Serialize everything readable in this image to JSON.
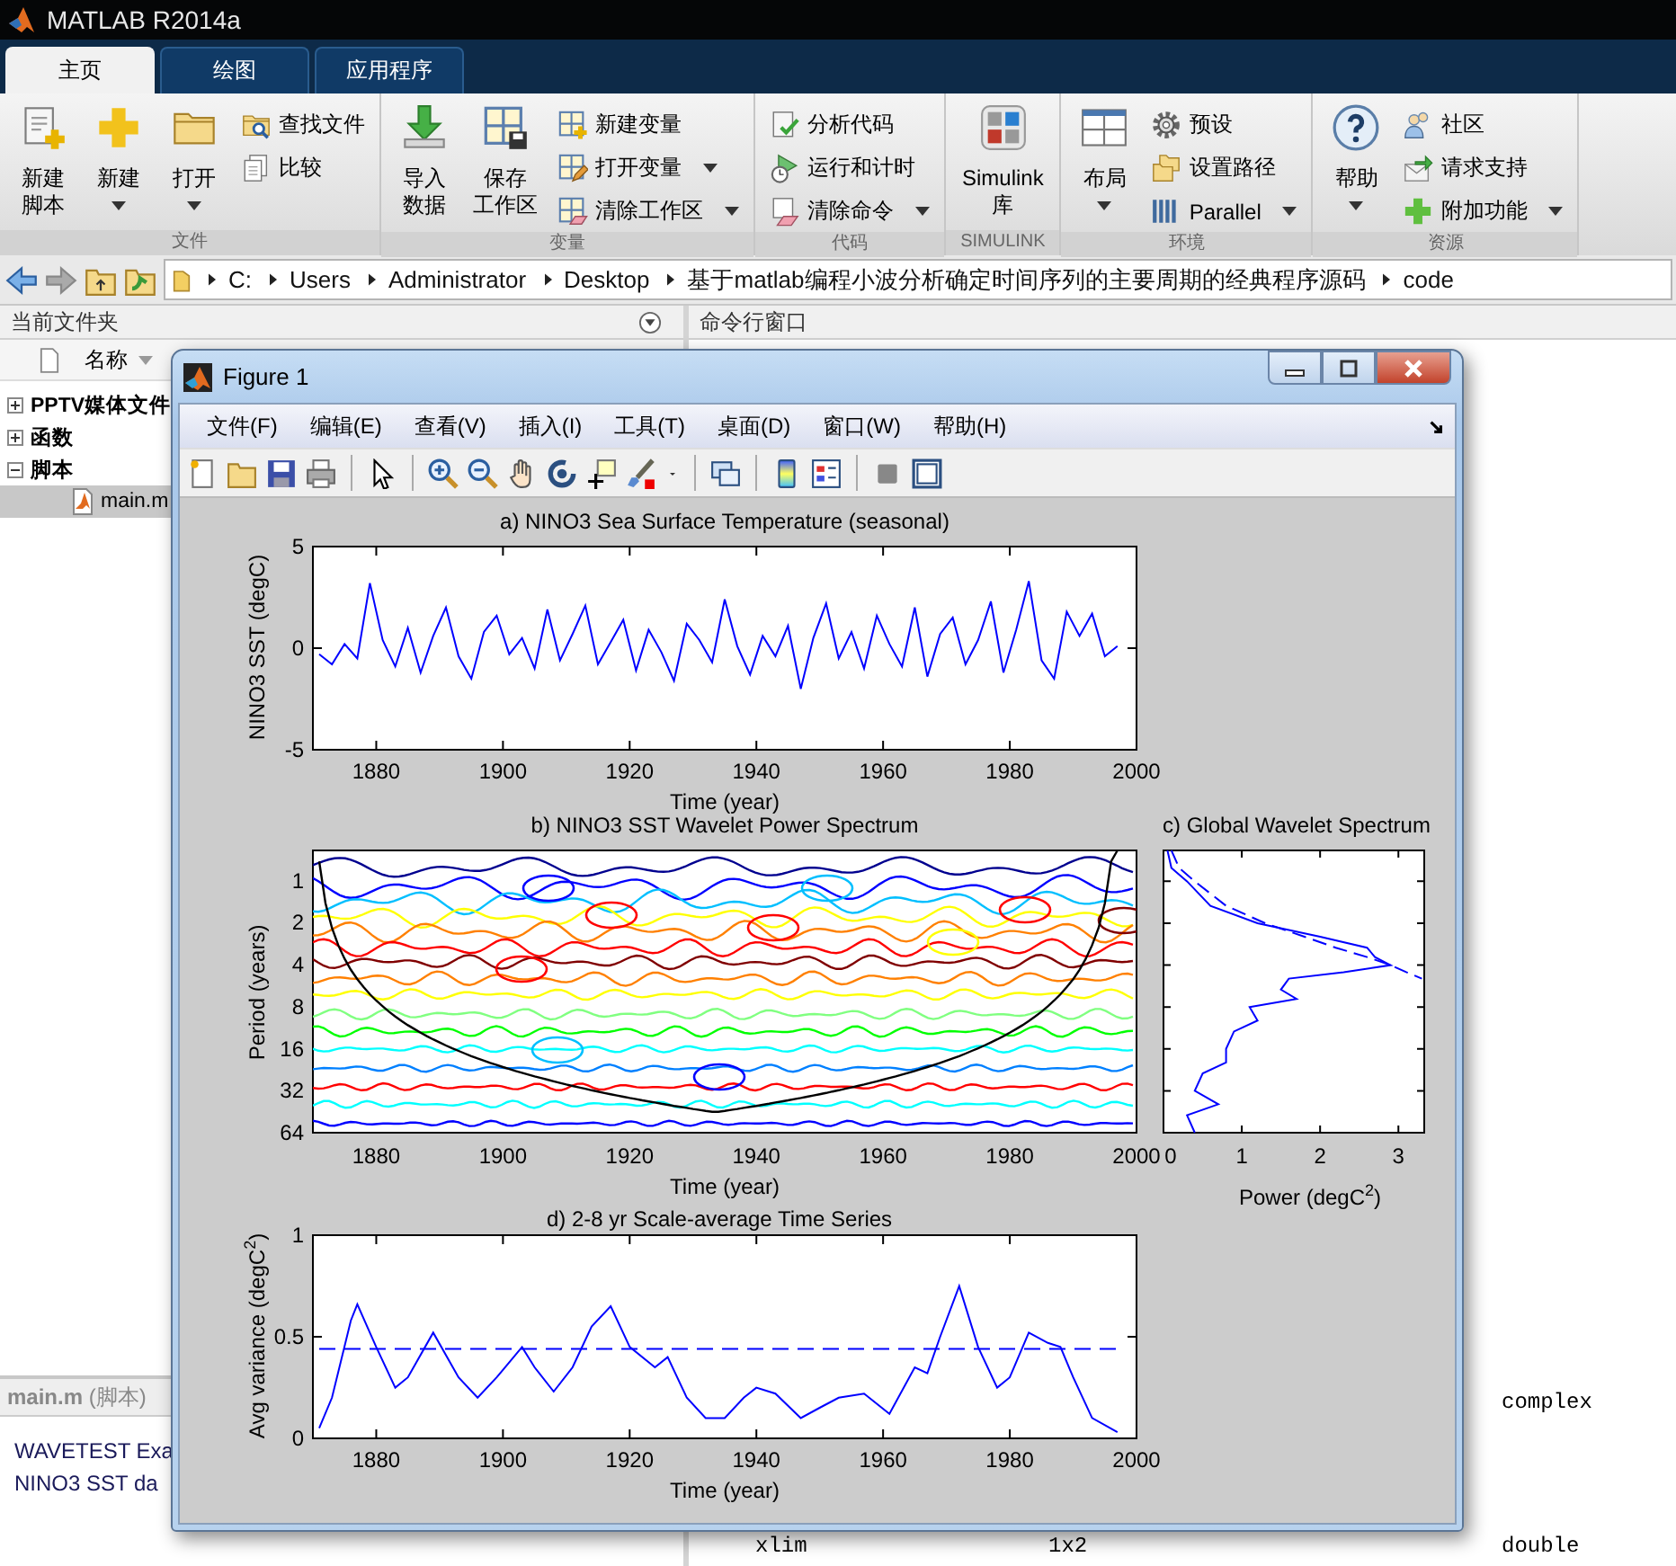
{
  "window": {
    "title": "MATLAB R2014a"
  },
  "tabs": [
    {
      "label": "主页",
      "selected": true
    },
    {
      "label": "绘图",
      "selected": false
    },
    {
      "label": "应用程序",
      "selected": false
    }
  ],
  "toolstrip": {
    "sections": [
      {
        "label": "文件",
        "items": [
          {
            "kind": "large",
            "lines": [
              "新建",
              "脚本"
            ],
            "dropdown": false
          },
          {
            "kind": "large",
            "lines": [
              "新建"
            ],
            "dropdown": true
          },
          {
            "kind": "large",
            "lines": [
              "打开"
            ],
            "dropdown": true
          },
          {
            "kind": "stack",
            "buttons": [
              {
                "label": "查找文件",
                "dropdown": false
              },
              {
                "label": "比较",
                "dropdown": false
              }
            ]
          }
        ]
      },
      {
        "label": "变量",
        "items": [
          {
            "kind": "large",
            "lines": [
              "导入",
              "数据"
            ],
            "dropdown": false
          },
          {
            "kind": "large",
            "lines": [
              "保存",
              "工作区"
            ],
            "dropdown": false
          },
          {
            "kind": "stack",
            "buttons": [
              {
                "label": "新建变量",
                "dropdown": false
              },
              {
                "label": "打开变量",
                "dropdown": true
              },
              {
                "label": "清除工作区",
                "dropdown": true
              }
            ]
          }
        ]
      },
      {
        "label": "代码",
        "items": [
          {
            "kind": "stack",
            "buttons": [
              {
                "label": "分析代码",
                "dropdown": false
              },
              {
                "label": "运行和计时",
                "dropdown": false
              },
              {
                "label": "清除命令",
                "dropdown": true
              }
            ]
          }
        ]
      },
      {
        "label": "SIMULINK",
        "items": [
          {
            "kind": "large",
            "lines": [
              "Simulink",
              "库"
            ],
            "dropdown": false
          }
        ]
      },
      {
        "label": "环境",
        "items": [
          {
            "kind": "large",
            "lines": [
              "布局"
            ],
            "dropdown": true
          },
          {
            "kind": "stack",
            "buttons": [
              {
                "label": "预设",
                "dropdown": false
              },
              {
                "label": "设置路径",
                "dropdown": false
              },
              {
                "label": "Parallel",
                "dropdown": true
              }
            ]
          }
        ]
      },
      {
        "label": "资源",
        "items": [
          {
            "kind": "large",
            "lines": [
              "帮助"
            ],
            "dropdown": true
          },
          {
            "kind": "stack",
            "buttons": [
              {
                "label": "社区",
                "dropdown": false
              },
              {
                "label": "请求支持",
                "dropdown": false
              },
              {
                "label": "附加功能",
                "dropdown": true
              }
            ]
          }
        ]
      }
    ]
  },
  "address_bar": {
    "path": [
      "C:",
      "Users",
      "Administrator",
      "Desktop",
      "基于matlab编程小波分析确定时间序列的主要周期的经典程序源码",
      "code"
    ]
  },
  "file_browser": {
    "title": "当前文件夹",
    "column": "名称",
    "items": [
      {
        "label": "PPTV媒体文件",
        "kind": "folder",
        "expanded": false,
        "selected": false
      },
      {
        "label": "函数",
        "kind": "folder",
        "expanded": false,
        "selected": false
      },
      {
        "label": "脚本",
        "kind": "folder",
        "expanded": true,
        "selected": false,
        "children": [
          {
            "label": "main.m",
            "kind": "file",
            "selected": true
          }
        ]
      }
    ]
  },
  "details": {
    "title": "**main.m** (脚本)",
    "lines": [
      "WAVETEST Exa",
      "NINO3 SST da"
    ]
  },
  "command_window": {
    "title": "命令行窗口",
    "rows": [
      {
        "column_3": "complex"
      },
      {
        "column_1": "xlim",
        "column_2": "1x2",
        "column_3": "double"
      }
    ]
  },
  "figure": {
    "title": "Figure 1",
    "menu": [
      "文件(F)",
      "编辑(E)",
      "查看(V)",
      "插入(I)",
      "工具(T)",
      "桌面(D)",
      "窗口(W)",
      "帮助(H)"
    ],
    "sst_plot": {
      "chart_data": {
        "type": "line",
        "title": "a) NINO3 Sea Surface Temperature (seasonal)",
        "xlabel": "Time (year)",
        "ylabel": "NINO3 SST (degC)",
        "x": [
          1871,
          1873,
          1875,
          1877,
          1879,
          1881,
          1883,
          1885,
          1887,
          1889,
          1891,
          1893,
          1895,
          1897,
          1899,
          1901,
          1903,
          1905,
          1907,
          1909,
          1911,
          1913,
          1915,
          1917,
          1919,
          1921,
          1923,
          1925,
          1927,
          1929,
          1931,
          1933,
          1935,
          1937,
          1939,
          1941,
          1943,
          1945,
          1947,
          1949,
          1951,
          1953,
          1955,
          1957,
          1959,
          1961,
          1963,
          1965,
          1967,
          1969,
          1971,
          1973,
          1975,
          1977,
          1979,
          1981,
          1983,
          1985,
          1987,
          1989,
          1991,
          1993,
          1995,
          1997
        ],
        "series": [
          {
            "color": "#0000ff",
            "values": [
              -0.3,
              -0.8,
              0.2,
              -0.5,
              3.2,
              0.4,
              -0.9,
              1.0,
              -1.2,
              0.6,
              2.0,
              -0.4,
              -1.5,
              0.8,
              1.6,
              -0.3,
              0.5,
              -1.0,
              1.9,
              -0.6,
              0.7,
              2.1,
              -0.8,
              0.3,
              1.4,
              -1.1,
              0.9,
              -0.2,
              -1.6,
              1.2,
              0.4,
              -0.7,
              2.4,
              0.1,
              -1.3,
              0.6,
              -0.4,
              1.1,
              -2.0,
              0.5,
              2.2,
              -0.5,
              0.8,
              -1.0,
              1.6,
              0.2,
              -0.9,
              2.0,
              -1.4,
              0.7,
              1.5,
              -0.8,
              0.4,
              2.3,
              -1.2,
              0.9,
              3.3,
              -0.6,
              -1.5,
              1.8,
              0.6,
              1.7,
              -0.4,
              0.1
            ]
          }
        ],
        "xlim": [
          1870,
          2000
        ],
        "ylim": [
          -5,
          5
        ],
        "xticks": [
          1880,
          1900,
          1920,
          1940,
          1960,
          1980,
          2000
        ],
        "yticks": [
          -5,
          0,
          5
        ]
      }
    },
    "wavelet_plot": {
      "title": "b) NINO3 SST Wavelet Power Spectrum",
      "xlabel": "Time (year)",
      "ylabel": "Period (years)",
      "xticks": [
        "1880",
        "1900",
        "1920",
        "1940",
        "1960",
        "1980",
        "2000"
      ],
      "yticks": [
        "1",
        "2",
        "4",
        "8",
        "16",
        "32",
        "64"
      ]
    },
    "global_spectrum": {
      "title": "c) Global Wavelet Spectrum",
      "xlabel": "Power (degC$^{2}$)",
      "xticks": [
        "0",
        "1",
        "2",
        "3"
      ]
    },
    "scale_average_plot": {
      "chart_data": {
        "type": "line",
        "title": "d) 2-8 yr Scale-average Time Series",
        "xlabel": "Time (year)",
        "ylabel": "Avg variance (degC$^{2}$)",
        "x": [
          1871,
          1873,
          1876,
          1877,
          1880,
          1883,
          1885,
          1889,
          1893,
          1896,
          1899,
          1903,
          1905,
          1908,
          1911,
          1914,
          1917,
          1920,
          1924,
          1926,
          1929,
          1932,
          1935,
          1938,
          1940,
          1943,
          1947,
          1950,
          1953,
          1957,
          1961,
          1965,
          1967,
          1969,
          1972,
          1975,
          1978,
          1980,
          1983,
          1986,
          1988,
          1990,
          1993,
          1997
        ],
        "series": [
          {
            "color": "#0000ff",
            "line_style": "solid",
            "values": [
              0.05,
              0.2,
              0.58,
              0.66,
              0.45,
              0.25,
              0.3,
              0.52,
              0.3,
              0.2,
              0.3,
              0.45,
              0.35,
              0.23,
              0.35,
              0.55,
              0.65,
              0.45,
              0.35,
              0.4,
              0.2,
              0.1,
              0.1,
              0.2,
              0.25,
              0.22,
              0.1,
              0.15,
              0.2,
              0.22,
              0.12,
              0.35,
              0.32,
              0.5,
              0.75,
              0.45,
              0.25,
              0.3,
              0.52,
              0.47,
              0.45,
              0.3,
              0.1,
              0.03
            ]
          },
          {
            "color": "#0000ff",
            "line_style": "dashed",
            "values": [
              0.44,
              0.44,
              0.44,
              0.44,
              0.44,
              0.44,
              0.44,
              0.44,
              0.44,
              0.44,
              0.44,
              0.44,
              0.44,
              0.44,
              0.44,
              0.44,
              0.44,
              0.44,
              0.44,
              0.44,
              0.44,
              0.44,
              0.44,
              0.44,
              0.44,
              0.44,
              0.44,
              0.44,
              0.44,
              0.44,
              0.44,
              0.44,
              0.44,
              0.44,
              0.44,
              0.44,
              0.44,
              0.44,
              0.44,
              0.44,
              0.44,
              0.44,
              0.44,
              0.44
            ]
          }
        ],
        "xlim": [
          1870,
          2000
        ],
        "ylim": [
          0,
          1
        ],
        "xticks": [
          1880,
          1900,
          1920,
          1940,
          1960,
          1980,
          2000
        ],
        "yticks": [
          0,
          0.5,
          1
        ]
      }
    }
  }
}
